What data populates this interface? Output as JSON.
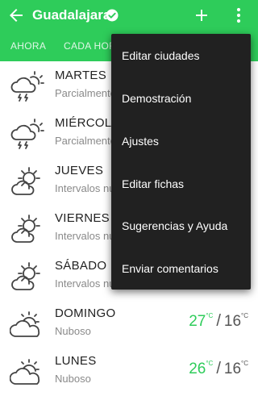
{
  "header": {
    "city": "Guadalajara"
  },
  "tabs": [
    {
      "label": "AHORA"
    },
    {
      "label": "CADA HORA"
    }
  ],
  "forecast": [
    {
      "day": "MARTES",
      "desc": "Parcialmente nublado",
      "icon": "storm-cloud-sun-icon"
    },
    {
      "day": "MIÉRCOLES",
      "desc": "Parcialmente nublado",
      "icon": "storm-cloud-sun-icon"
    },
    {
      "day": "JUEVES",
      "desc": "Intervalos nubosos",
      "icon": "partly-cloudy-icon"
    },
    {
      "day": "VIERNES",
      "desc": "Intervalos nubosos",
      "icon": "partly-cloudy-icon"
    },
    {
      "day": "SÁBADO",
      "desc": "Intervalos nubosos",
      "icon": "partly-cloudy-icon"
    },
    {
      "day": "DOMINGO",
      "desc": "Nuboso",
      "icon": "cloudy-icon",
      "high": "27",
      "low": "16",
      "unit": "°C"
    },
    {
      "day": "LUNES",
      "desc": "Nuboso",
      "icon": "cloudy-icon",
      "high": "26",
      "low": "16",
      "unit": "°C"
    }
  ],
  "menu": {
    "items": [
      "Editar ciudades",
      "Demostración",
      "Ajustes",
      "Editar fichas",
      "Sugerencias y Ayuda",
      "Enviar comentarios"
    ]
  },
  "colors": {
    "accent": "#2ecc5a",
    "menu_bg": "#212121",
    "text": "#222222",
    "secondary": "#8a8a8a"
  }
}
